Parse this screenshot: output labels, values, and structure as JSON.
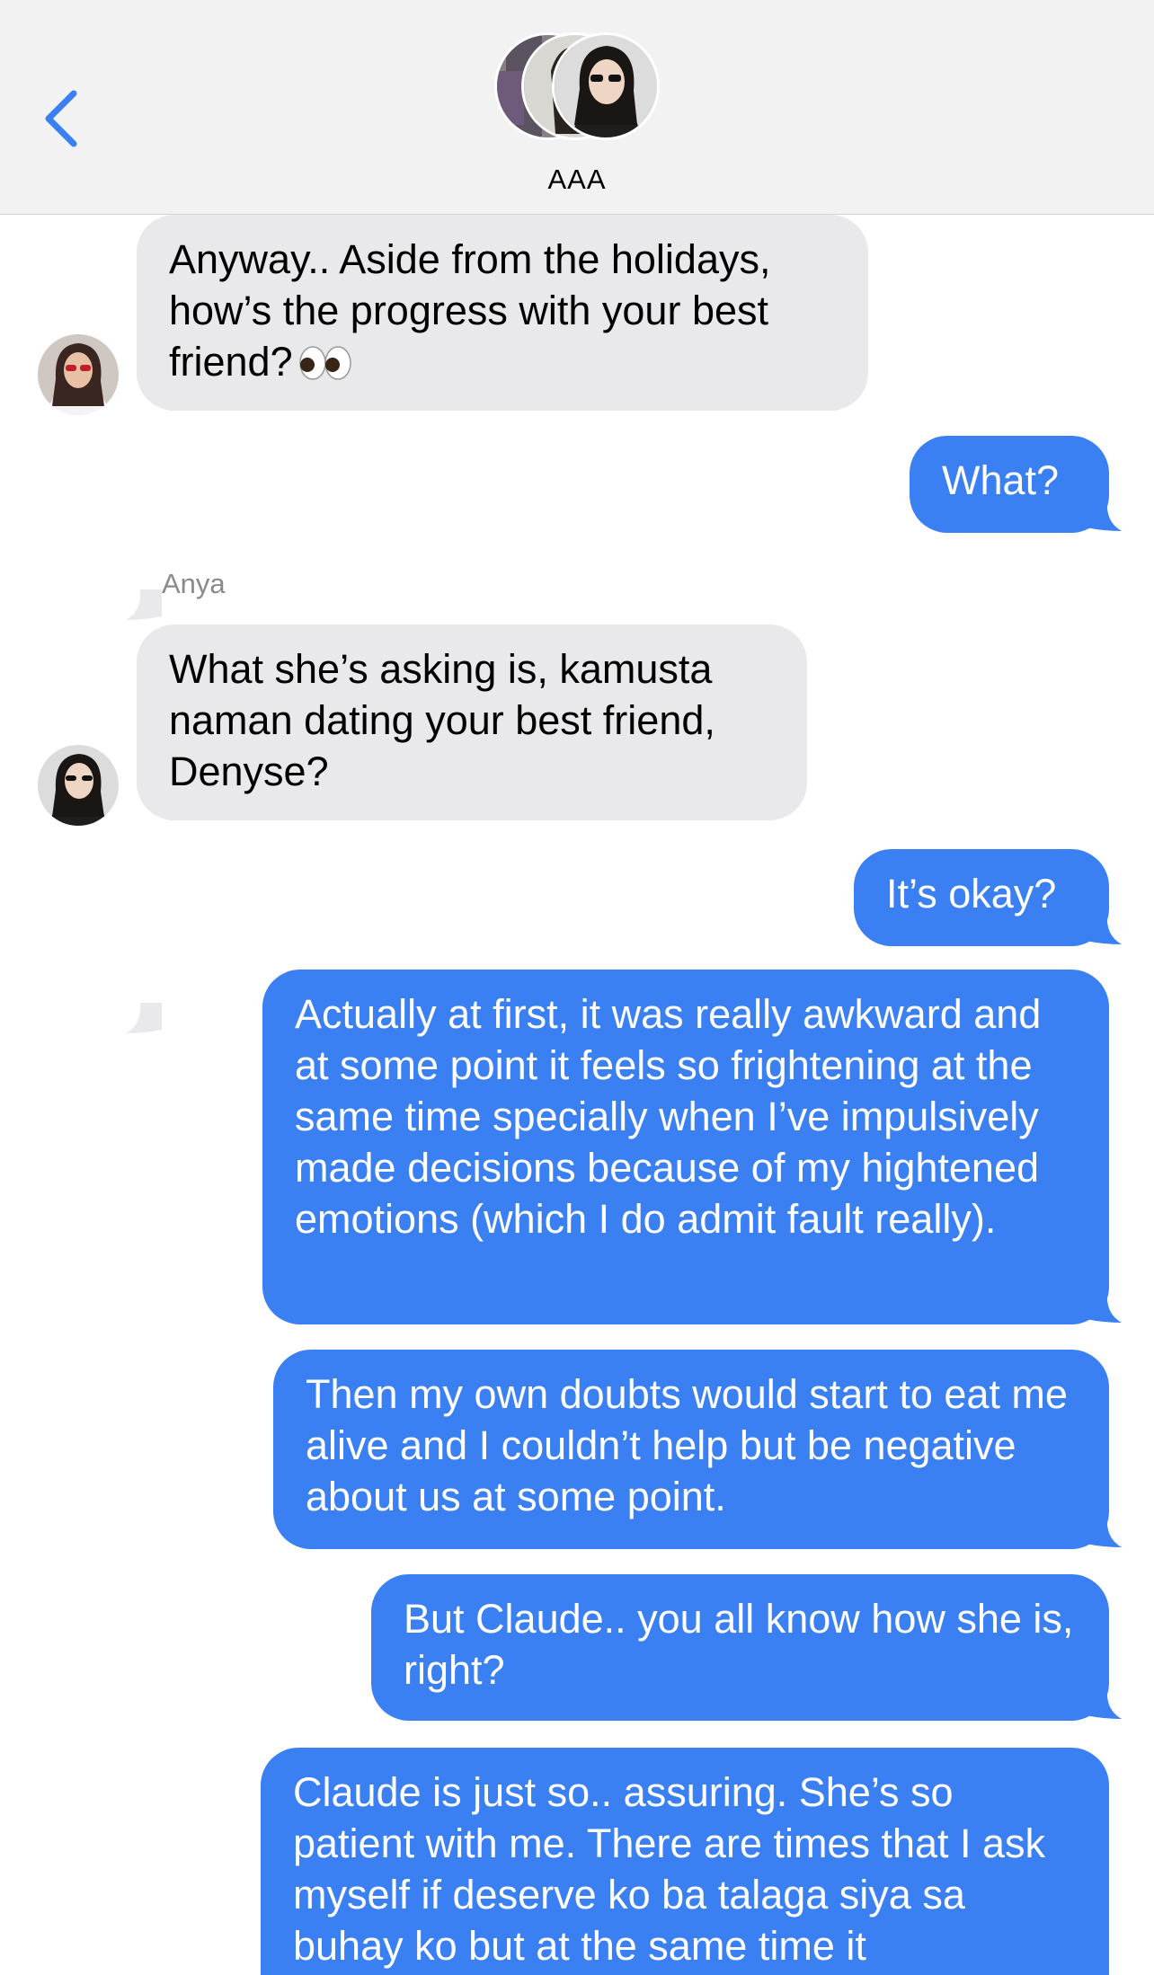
{
  "header": {
    "group_name": "AAA",
    "back_icon": "chevron-left-icon",
    "accent_color": "#3a80f2"
  },
  "messages": {
    "m1": {
      "direction": "incoming",
      "text": "Anyway.. Aside from the holidays, how’s the progress with your best friend?",
      "emoji": "👀"
    },
    "m2": {
      "direction": "outgoing",
      "text": "What?"
    },
    "m3": {
      "direction": "incoming",
      "sender": "Anya",
      "text": "What she’s asking is, kamusta naman dating your best friend, Denyse?"
    },
    "m4": {
      "direction": "outgoing",
      "text": "It’s okay?"
    },
    "m5": {
      "direction": "outgoing",
      "text": "Actually at first, it was really awkward and at some point it feels so frightening at the same time specially when I’ve impulsively made decisions because of my hightened emotions (which I do admit fault really)."
    },
    "m6": {
      "direction": "outgoing",
      "text": "Then my own doubts would start to eat me alive and I couldn’t help but be negative about us at some point."
    },
    "m7": {
      "direction": "outgoing",
      "text": "But Claude.. you all know how she is, right?"
    },
    "m8": {
      "direction": "outgoing",
      "text": "Claude is just so.. assuring. She’s so patient with me. There are times that I ask myself if deserve ko ba talaga siya sa buhay ko but at the same time it"
    }
  },
  "colors": {
    "outgoing_bubble": "#3a80f2",
    "incoming_bubble": "#e9e9eb"
  }
}
